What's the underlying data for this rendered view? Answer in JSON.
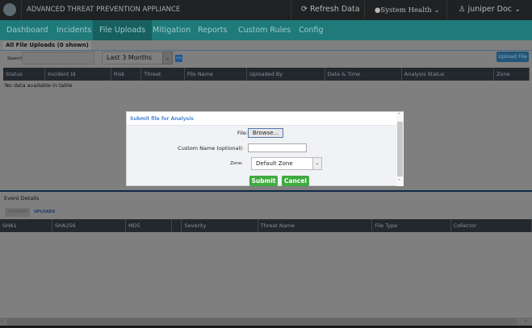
{
  "app": {
    "title": "ADVANCED THREAT PREVENTION APPLIANCE",
    "refresh": "Refresh Data",
    "health": "System  Health",
    "user": "juniper Doc"
  },
  "nav": [
    "Dashboard",
    "Incidents",
    "File Uploads",
    "Mitigation",
    "Reports",
    "Custom Rules",
    "Config"
  ],
  "nav_active": "File Uploads",
  "uploads": {
    "tab": "All File Uploads (0 shown)",
    "search_label": "Search:",
    "search_value": "",
    "range": "Last 3 Months",
    "csv": "CSV",
    "upload_btn": "Upload File",
    "columns": [
      "Status",
      "Incident Id",
      "Risk",
      "Threat",
      "File Name",
      "Uploaded By",
      "Date & Time",
      "Analysis Status",
      "Zone"
    ],
    "empty": "No data available in table"
  },
  "events": {
    "title": "Event Details",
    "tabs": [
      "SUMMARY",
      "UPLOADS"
    ],
    "active_tab": "UPLOADS",
    "columns": [
      "SHA1",
      "SHA256",
      "MD5",
      "",
      "Severity",
      "Threat Name",
      "File Type",
      "Collector"
    ]
  },
  "modal": {
    "title": "Submit file for Analysis",
    "file_label": "File:",
    "browse": "Browse...",
    "custom_label": "Custom Name (optional):",
    "custom_value": "",
    "zone_label": "Zone:",
    "zone_value": "Default Zone",
    "submit": "Submit",
    "cancel": "Cancel"
  },
  "colors": {
    "nav": "#1f7a7a",
    "header": "#23282f",
    "accent": "#4a8ad8",
    "submit": "#3faa3f"
  }
}
